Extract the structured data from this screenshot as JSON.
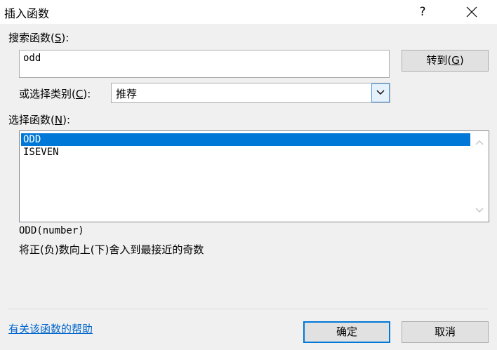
{
  "window": {
    "title": "插入函数",
    "help_glyph": "?",
    "close_glyph": "×"
  },
  "search": {
    "label_prefix": "搜索函数(",
    "label_key": "S",
    "label_suffix": "):",
    "value": "odd",
    "goto_prefix": "转到(",
    "goto_key": "G",
    "goto_suffix": ")"
  },
  "category": {
    "label_prefix": "或选择类别(",
    "label_key": "C",
    "label_suffix": "):",
    "selected": "推荐"
  },
  "functions": {
    "label_prefix": "选择函数(",
    "label_key": "N",
    "label_suffix": "):",
    "items": [
      {
        "name": "ODD",
        "selected": true
      },
      {
        "name": "ISEVEN",
        "selected": false
      }
    ]
  },
  "details": {
    "signature": "ODD(number)",
    "description": "将正(负)数向上(下)舍入到最接近的奇数"
  },
  "footer": {
    "help_link": "有关该函数的帮助",
    "ok_label": "确定",
    "cancel_label": "取消"
  },
  "colors": {
    "accent": "#0078d7",
    "link": "#0066cc"
  }
}
